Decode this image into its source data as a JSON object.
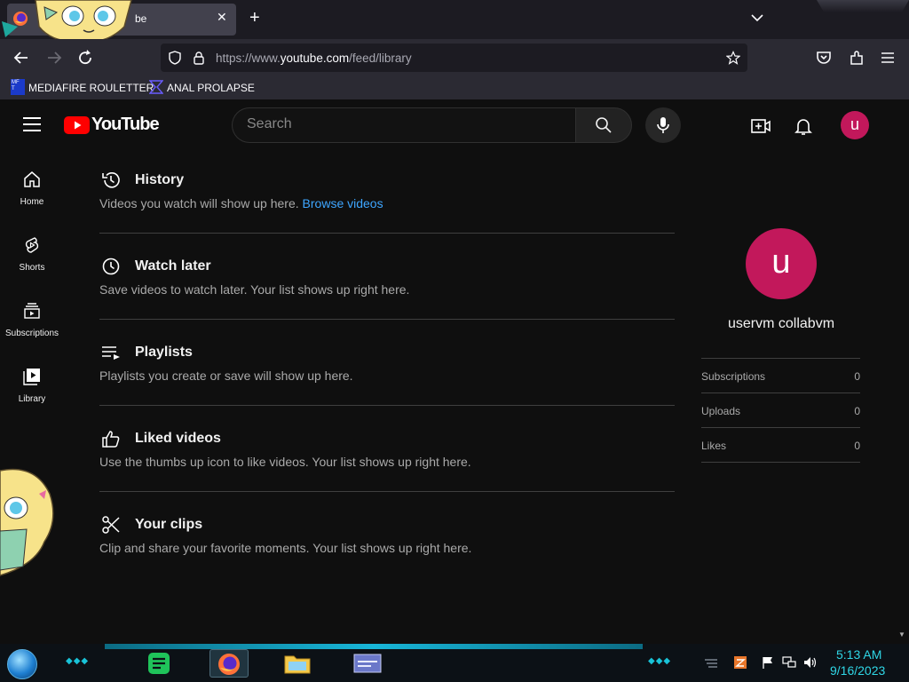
{
  "browser": {
    "tab_title": "be",
    "url_prefix": "https://www.",
    "url_domain": "youtube.com",
    "url_path": "/feed/library",
    "bookmarks": [
      {
        "label": "MEDIAFIRE ROULETTER"
      },
      {
        "label": "ANAL PROLAPSE"
      }
    ]
  },
  "youtube": {
    "logo_text": "YouTube",
    "search_placeholder": "Search",
    "avatar_letter": "u",
    "sidebar": [
      {
        "label": "Home"
      },
      {
        "label": "Shorts"
      },
      {
        "label": "Subscriptions"
      },
      {
        "label": "Library"
      }
    ],
    "sections": [
      {
        "title": "History",
        "description": "Videos you watch will show up here.",
        "link": "Browse videos"
      },
      {
        "title": "Watch later",
        "description": "Save videos to watch later. Your list shows up right here."
      },
      {
        "title": "Playlists",
        "description": "Playlists you create or save will show up here."
      },
      {
        "title": "Liked videos",
        "description": "Use the thumbs up icon to like videos. Your list shows up right here."
      },
      {
        "title": "Your clips",
        "description": "Clip and share your favorite moments. Your list shows up right here."
      }
    ],
    "profile": {
      "letter": "u",
      "name": "uservm collabvm",
      "stats": [
        {
          "label": "Subscriptions",
          "value": "0"
        },
        {
          "label": "Uploads",
          "value": "0"
        },
        {
          "label": "Likes",
          "value": "0"
        }
      ]
    }
  },
  "taskbar": {
    "time": "5:13 AM",
    "date": "9/16/2023"
  },
  "colors": {
    "brand_red": "#ff0000",
    "avatar": "#c2185b",
    "link": "#3ea6ff",
    "clock": "#2fd7e6"
  }
}
